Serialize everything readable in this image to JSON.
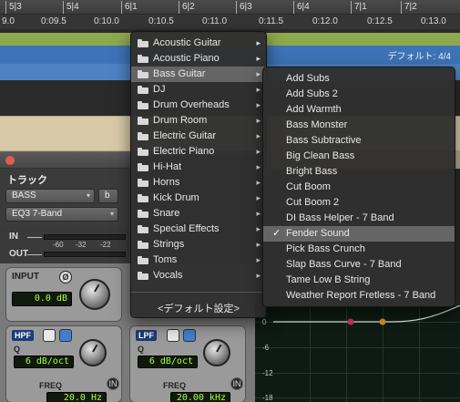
{
  "ruler": {
    "bars": [
      "5|3",
      "5|4",
      "6|1",
      "6|2",
      "6|3",
      "6|4",
      "7|1",
      "7|2"
    ],
    "times": [
      "9.0",
      "0:09.5",
      "0:10.0",
      "0:10.5",
      "0:11.0",
      "0:11.5",
      "0:12.0",
      "0:12.5",
      "0:13.0"
    ]
  },
  "arrange": {
    "time_signature": "デフォルト: 4/4",
    "colors": {
      "green_track": "#8ea84d",
      "blue_track": "#3d74b8",
      "region": "#d8c9a8"
    }
  },
  "plugin": {
    "section_label": "トラック",
    "track_select": "BASS",
    "track_suffix": "b",
    "plugin_select": "EQ3 7-Band",
    "io": {
      "in_label": "IN",
      "out_label": "OUT",
      "scale": [
        "-60",
        "-32",
        "-22"
      ]
    },
    "input": {
      "label": "INPUT",
      "phase_symbol": "Ø",
      "value": "0.0 dB"
    },
    "hpf": {
      "label": "HPF",
      "q_label": "Q",
      "slope": "6 dB/oct",
      "freq_label": "FREQ",
      "freq_value": "20.0 Hz",
      "in_button": "IN"
    },
    "lpf": {
      "label": "LPF",
      "q_label": "Q",
      "slope": "6 dB/oct",
      "freq_label": "FREQ",
      "freq_value": "20.00 kHz",
      "in_button": "IN"
    }
  },
  "graph": {
    "db_labels": [
      "0",
      "-6",
      "-12",
      "-18"
    ]
  },
  "menu_main": {
    "items": [
      {
        "label": "Acoustic Guitar",
        "folder": true,
        "submenu": true,
        "highlighted": false
      },
      {
        "label": "Acoustic Piano",
        "folder": true,
        "submenu": true,
        "highlighted": false
      },
      {
        "label": "Bass Guitar",
        "folder": true,
        "submenu": true,
        "highlighted": true
      },
      {
        "label": "DJ",
        "folder": true,
        "submenu": true,
        "highlighted": false
      },
      {
        "label": "Drum Overheads",
        "folder": true,
        "submenu": true,
        "highlighted": false
      },
      {
        "label": "Drum Room",
        "folder": true,
        "submenu": true,
        "highlighted": false
      },
      {
        "label": "Electric Guitar",
        "folder": true,
        "submenu": true,
        "highlighted": false
      },
      {
        "label": "Electric Piano",
        "folder": true,
        "submenu": true,
        "highlighted": false
      },
      {
        "label": "Hi-Hat",
        "folder": true,
        "submenu": true,
        "highlighted": false
      },
      {
        "label": "Horns",
        "folder": true,
        "submenu": true,
        "highlighted": false
      },
      {
        "label": "Kick Drum",
        "folder": true,
        "submenu": true,
        "highlighted": false
      },
      {
        "label": "Snare",
        "folder": true,
        "submenu": true,
        "highlighted": false
      },
      {
        "label": "Special Effects",
        "folder": true,
        "submenu": true,
        "highlighted": false
      },
      {
        "label": "Strings",
        "folder": true,
        "submenu": true,
        "highlighted": false
      },
      {
        "label": "Toms",
        "folder": true,
        "submenu": true,
        "highlighted": false
      },
      {
        "label": "Vocals",
        "folder": true,
        "submenu": true,
        "highlighted": false
      }
    ],
    "default_item": "<デフォルト設定>"
  },
  "menu_sub": {
    "items": [
      {
        "label": "Add Subs",
        "checked": false,
        "highlighted": false
      },
      {
        "label": "Add Subs 2",
        "checked": false,
        "highlighted": false
      },
      {
        "label": "Add Warmth",
        "checked": false,
        "highlighted": false
      },
      {
        "label": "Bass Monster",
        "checked": false,
        "highlighted": false
      },
      {
        "label": "Bass Subtractive",
        "checked": false,
        "highlighted": false
      },
      {
        "label": "Big Clean Bass",
        "checked": false,
        "highlighted": false
      },
      {
        "label": "Bright Bass",
        "checked": false,
        "highlighted": false
      },
      {
        "label": "Cut Boom",
        "checked": false,
        "highlighted": false
      },
      {
        "label": "Cut Boom 2",
        "checked": false,
        "highlighted": false
      },
      {
        "label": "DI Bass Helper - 7 Band",
        "checked": false,
        "highlighted": false
      },
      {
        "label": "Fender Sound",
        "checked": true,
        "highlighted": true
      },
      {
        "label": "Pick Bass Crunch",
        "checked": false,
        "highlighted": false
      },
      {
        "label": "Slap Bass Curve - 7 Band",
        "checked": false,
        "highlighted": false
      },
      {
        "label": "Tame Low B String",
        "checked": false,
        "highlighted": false
      },
      {
        "label": "Weather Report Fretless - 7 Band",
        "checked": false,
        "highlighted": false
      }
    ],
    "check_symbol": "✓"
  }
}
